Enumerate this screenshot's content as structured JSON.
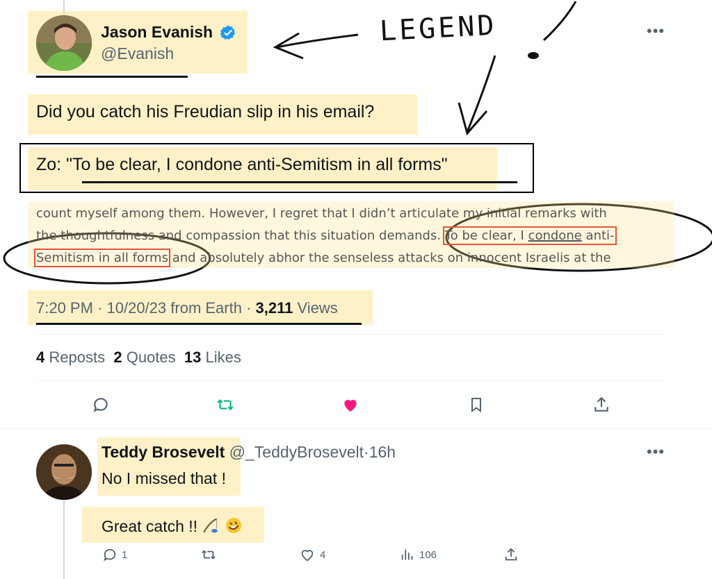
{
  "tweet": {
    "author_name": "Jason Evanish",
    "author_handle": "@Evanish",
    "text": "Did you catch his Freudian slip in his email?",
    "quote_line": "Zo: \"To be clear, I condone anti-Semitism in all forms\"",
    "email_excerpt": {
      "line1": "count myself among them. However, I regret that I didn’t articulate my initial remarks with",
      "line2_a": "the thoughtfulness and compassion that this situation demands. ",
      "line2_b": "To be clear, I ",
      "line2_c": "condone",
      "line2_d": " anti-",
      "line3_a": "Semitism in all forms",
      "line3_b": " and absolutely abhor the senseless attacks on innocent Israelis at the"
    },
    "time": "7:20 PM",
    "date": "10/20/23",
    "source": "from Earth",
    "views_count": "3,211",
    "views_label": "Views",
    "reposts_count": "4",
    "reposts_label": "Reposts",
    "quotes_count": "2",
    "quotes_label": "Quotes",
    "likes_count": "13",
    "likes_label": "Likes"
  },
  "annotation": {
    "legend_text": "LEGEND"
  },
  "reply": {
    "author_name": "Teddy Brosevelt",
    "author_handle": "@_TeddyBrosevelt",
    "age": "16h",
    "line1": "No I missed that !",
    "line2": "Great catch !!",
    "replies_count": "1",
    "likes_count": "4",
    "views_count": "106"
  },
  "colors": {
    "verified": "#1d9bf0",
    "repost_active": "#00ba7c",
    "like_active": "#f91880",
    "highlight": "#ffe082",
    "redbox": "#e2553d"
  },
  "icons": [
    "verified-badge-icon",
    "more-icon",
    "reply-icon",
    "repost-icon",
    "like-icon",
    "bookmark-icon",
    "share-icon",
    "views-icon"
  ]
}
